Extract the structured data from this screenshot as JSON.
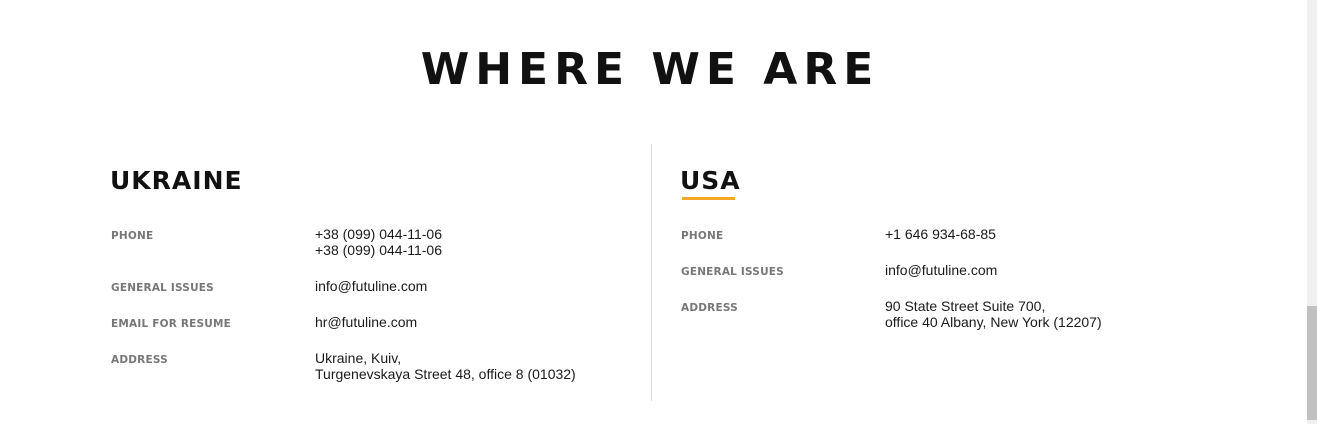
{
  "page_title": "WHERE WE ARE",
  "ukraine": {
    "title": "UKRAINE",
    "phone_label": "PHONE",
    "phone_1": "+38 (099) 044-11-06",
    "phone_2": "+38 (099) 044-11-06",
    "general_label": "GENERAL ISSUES",
    "general_email": "info@futuline.com",
    "resume_label": "EMAIL FOR RESUME",
    "resume_email": "hr@futuline.com",
    "address_label": "ADDRESS",
    "address_line_1": "Ukraine, Kuiv,",
    "address_line_2": "Turgenevskaya Street 48, office 8 (01032)"
  },
  "usa": {
    "title": "USA",
    "phone_label": "PHONE",
    "phone_1": "+1 646 934-68-85",
    "general_label": "GENERAL ISSUES",
    "general_email": "info@futuline.com",
    "address_label": "ADDRESS",
    "address_line_1": "90 State Street Suite 700,",
    "address_line_2": "office 40 Albany, New York (12207)"
  },
  "colors": {
    "accent": "#f5a623",
    "title": "#111111",
    "label": "#777777",
    "divider": "#dcdcdc"
  }
}
